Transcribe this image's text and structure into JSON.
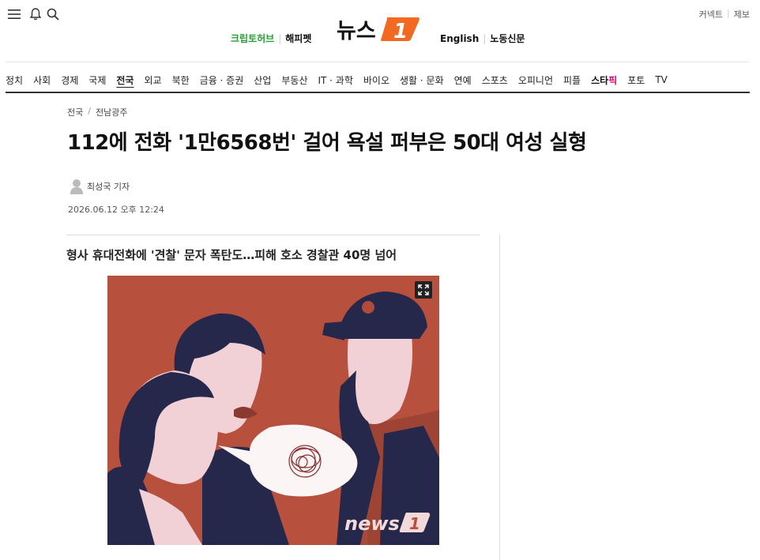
{
  "header": {
    "left_links": {
      "crypto": "크립토허브",
      "happy": "해피펫"
    },
    "right_links": {
      "english": "English",
      "labor": "노동신문"
    },
    "util": {
      "connect": "커넥트",
      "report": "제보"
    },
    "logo_text": "뉴스",
    "logo_badge": "1",
    "separator": "|"
  },
  "nav": {
    "items": [
      "정치",
      "사회",
      "경제",
      "국제",
      "전국",
      "외교",
      "북한",
      "금융 · 증권",
      "산업",
      "부동산",
      "IT · 과학",
      "바이오",
      "생활 · 문화",
      "연예",
      "스포츠",
      "오피니언",
      "피플"
    ],
    "star_a": "스타",
    "star_b": "픽",
    "after_star": [
      "포토",
      "TV"
    ],
    "active": "전국"
  },
  "article": {
    "breadcrumb": [
      "전국",
      "전남광주"
    ],
    "breadcrumb_sep": "/",
    "headline": "112에 전화 '1만6568번' 걸어 욕설 퍼부은 50대 여성 실형",
    "author": "최성국 기자",
    "date": "2026.06.12 오후 12:24",
    "subtitle": "형사 휴대전화에 '견찰' 문자 폭탄도…피해 호소 경찰관 40명 넘어",
    "photo_watermark": "news",
    "photo_watermark_badge": "1"
  },
  "colors": {
    "green": "#2a9d3a",
    "star_pink": "#e6007e",
    "logo_orange": "#f26a21",
    "photo_bg": "#b8503e"
  }
}
